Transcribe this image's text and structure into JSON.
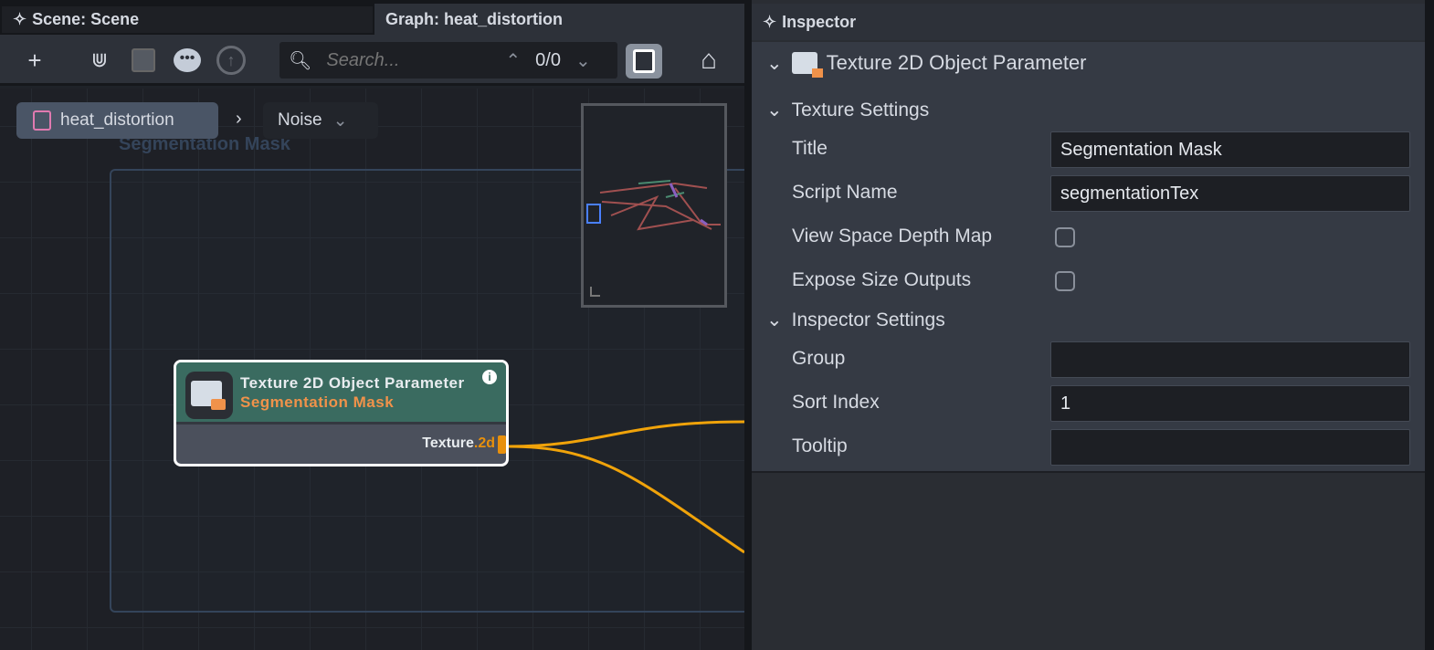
{
  "tabs": {
    "scene": "Scene: Scene",
    "graph": "Graph: heat_distortion"
  },
  "toolbar": {
    "search_placeholder": "Search...",
    "search_count": "0/0"
  },
  "breadcrumb": {
    "root": "heat_distortion",
    "child": "Noise",
    "separator": "›"
  },
  "group": {
    "title": "Segmentation Mask"
  },
  "node": {
    "title": "Texture 2D Object Parameter",
    "subtitle": "Segmentation Mask",
    "port_name": "Texture",
    "port_type": ".2d",
    "info": "i"
  },
  "colors": {
    "wire": "#f0a30a",
    "node_header": "#3a6b60",
    "accent_orange": "#f0924a"
  },
  "inspector": {
    "tab": "Inspector",
    "object_title": "Texture 2D Object Parameter",
    "texture_settings": {
      "label": "Texture Settings",
      "title_label": "Title",
      "title_value": "Segmentation Mask",
      "script_label": "Script Name",
      "script_value": "segmentationTex",
      "depth_label": "View Space Depth Map",
      "depth_checked": false,
      "expose_label": "Expose Size Outputs",
      "expose_checked": false
    },
    "inspector_settings": {
      "label": "Inspector Settings",
      "group_label": "Group",
      "group_value": "",
      "sort_label": "Sort Index",
      "sort_value": "1",
      "tooltip_label": "Tooltip",
      "tooltip_value": ""
    }
  }
}
